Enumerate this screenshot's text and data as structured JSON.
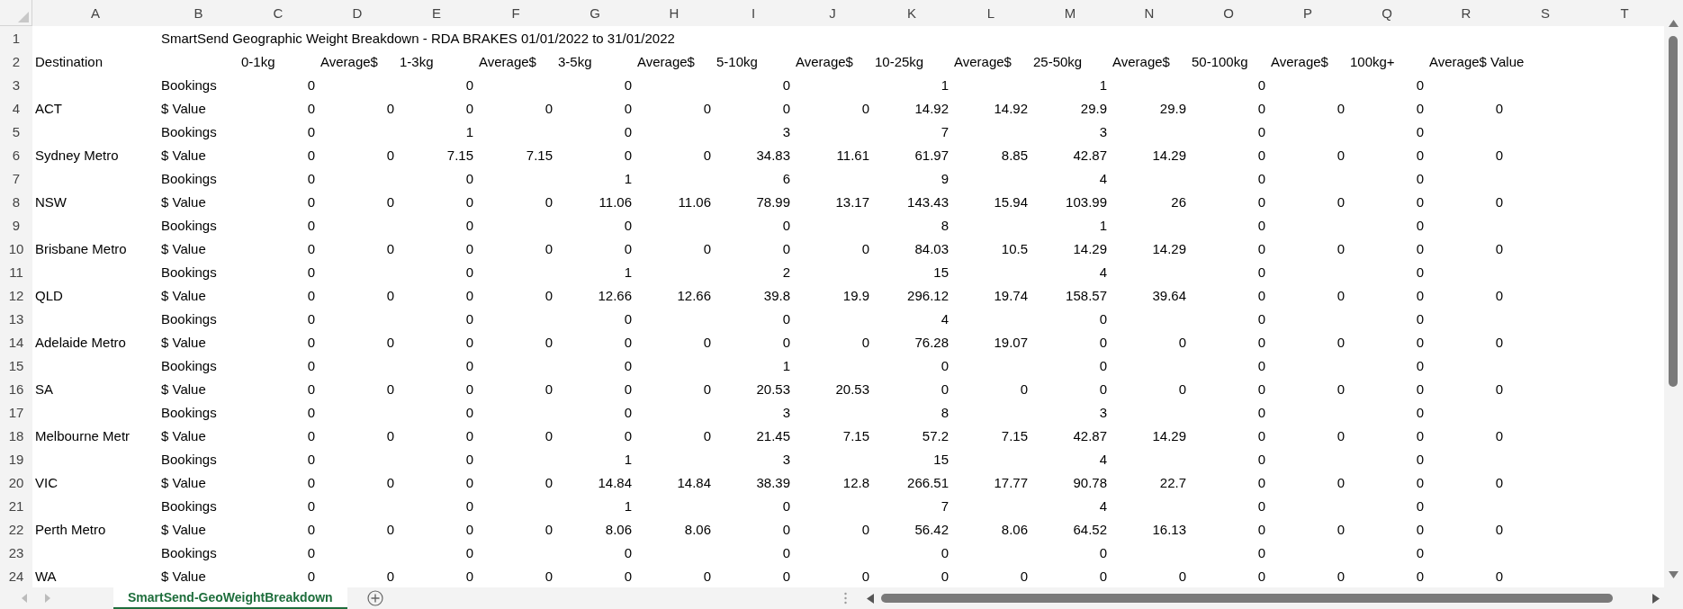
{
  "columns": [
    "A",
    "B",
    "C",
    "D",
    "E",
    "F",
    "G",
    "H",
    "I",
    "J",
    "K",
    "L",
    "M",
    "N",
    "O",
    "P",
    "Q",
    "R",
    "S",
    "T"
  ],
  "rows": [
    {
      "number": "1",
      "kind": "title",
      "cells": [
        null,
        "SmartSend Geographic Weight Breakdown - RDA BRAKES 01/01/2022 to 31/01/2022"
      ]
    },
    {
      "number": "2",
      "kind": "header",
      "cells": [
        "Destination",
        null,
        "0-1kg",
        "Average$",
        "1-3kg",
        "Average$",
        "3-5kg",
        "Average$",
        "5-10kg",
        "Average$",
        "10-25kg",
        "Average$",
        "25-50kg",
        "Average$",
        "50-100kg",
        "Average$",
        "100kg+",
        "Average$ Value"
      ]
    },
    {
      "number": "3",
      "kind": "data",
      "cells": [
        null,
        "Bookings",
        "0",
        null,
        "0",
        null,
        "0",
        null,
        "0",
        null,
        "1",
        null,
        "1",
        null,
        "0",
        null,
        "0",
        null
      ]
    },
    {
      "number": "4",
      "kind": "data",
      "cells": [
        "ACT",
        "$ Value",
        "0",
        "0",
        "0",
        "0",
        "0",
        "0",
        "0",
        "0",
        "14.92",
        "14.92",
        "29.9",
        "29.9",
        "0",
        "0",
        "0",
        "0"
      ]
    },
    {
      "number": "5",
      "kind": "data",
      "cells": [
        null,
        "Bookings",
        "0",
        null,
        "1",
        null,
        "0",
        null,
        "3",
        null,
        "7",
        null,
        "3",
        null,
        "0",
        null,
        "0",
        null
      ]
    },
    {
      "number": "6",
      "kind": "data",
      "cells": [
        "Sydney Metro",
        "$ Value",
        "0",
        "0",
        "7.15",
        "7.15",
        "0",
        "0",
        "34.83",
        "11.61",
        "61.97",
        "8.85",
        "42.87",
        "14.29",
        "0",
        "0",
        "0",
        "0"
      ]
    },
    {
      "number": "7",
      "kind": "data",
      "cells": [
        null,
        "Bookings",
        "0",
        null,
        "0",
        null,
        "1",
        null,
        "6",
        null,
        "9",
        null,
        "4",
        null,
        "0",
        null,
        "0",
        null
      ]
    },
    {
      "number": "8",
      "kind": "data",
      "cells": [
        "NSW",
        "$ Value",
        "0",
        "0",
        "0",
        "0",
        "11.06",
        "11.06",
        "78.99",
        "13.17",
        "143.43",
        "15.94",
        "103.99",
        "26",
        "0",
        "0",
        "0",
        "0"
      ]
    },
    {
      "number": "9",
      "kind": "data",
      "cells": [
        null,
        "Bookings",
        "0",
        null,
        "0",
        null,
        "0",
        null,
        "0",
        null,
        "8",
        null,
        "1",
        null,
        "0",
        null,
        "0",
        null
      ]
    },
    {
      "number": "10",
      "kind": "data",
      "cells": [
        "Brisbane Metro",
        "$ Value",
        "0",
        "0",
        "0",
        "0",
        "0",
        "0",
        "0",
        "0",
        "84.03",
        "10.5",
        "14.29",
        "14.29",
        "0",
        "0",
        "0",
        "0"
      ]
    },
    {
      "number": "11",
      "kind": "data",
      "cells": [
        null,
        "Bookings",
        "0",
        null,
        "0",
        null,
        "1",
        null,
        "2",
        null,
        "15",
        null,
        "4",
        null,
        "0",
        null,
        "0",
        null
      ]
    },
    {
      "number": "12",
      "kind": "data",
      "cells": [
        "QLD",
        "$ Value",
        "0",
        "0",
        "0",
        "0",
        "12.66",
        "12.66",
        "39.8",
        "19.9",
        "296.12",
        "19.74",
        "158.57",
        "39.64",
        "0",
        "0",
        "0",
        "0"
      ]
    },
    {
      "number": "13",
      "kind": "data",
      "cells": [
        null,
        "Bookings",
        "0",
        null,
        "0",
        null,
        "0",
        null,
        "0",
        null,
        "4",
        null,
        "0",
        null,
        "0",
        null,
        "0",
        null
      ]
    },
    {
      "number": "14",
      "kind": "data",
      "cells": [
        "Adelaide Metro",
        "$ Value",
        "0",
        "0",
        "0",
        "0",
        "0",
        "0",
        "0",
        "0",
        "76.28",
        "19.07",
        "0",
        "0",
        "0",
        "0",
        "0",
        "0"
      ]
    },
    {
      "number": "15",
      "kind": "data",
      "cells": [
        null,
        "Bookings",
        "0",
        null,
        "0",
        null,
        "0",
        null,
        "1",
        null,
        "0",
        null,
        "0",
        null,
        "0",
        null,
        "0",
        null
      ]
    },
    {
      "number": "16",
      "kind": "data",
      "cells": [
        "SA",
        "$ Value",
        "0",
        "0",
        "0",
        "0",
        "0",
        "0",
        "20.53",
        "20.53",
        "0",
        "0",
        "0",
        "0",
        "0",
        "0",
        "0",
        "0"
      ]
    },
    {
      "number": "17",
      "kind": "data",
      "cells": [
        null,
        "Bookings",
        "0",
        null,
        "0",
        null,
        "0",
        null,
        "3",
        null,
        "8",
        null,
        "3",
        null,
        "0",
        null,
        "0",
        null
      ]
    },
    {
      "number": "18",
      "kind": "data",
      "cells": [
        "Melbourne Metr",
        "$ Value",
        "0",
        "0",
        "0",
        "0",
        "0",
        "0",
        "21.45",
        "7.15",
        "57.2",
        "7.15",
        "42.87",
        "14.29",
        "0",
        "0",
        "0",
        "0"
      ]
    },
    {
      "number": "19",
      "kind": "data",
      "cells": [
        null,
        "Bookings",
        "0",
        null,
        "0",
        null,
        "1",
        null,
        "3",
        null,
        "15",
        null,
        "4",
        null,
        "0",
        null,
        "0",
        null
      ]
    },
    {
      "number": "20",
      "kind": "data",
      "cells": [
        "VIC",
        "$ Value",
        "0",
        "0",
        "0",
        "0",
        "14.84",
        "14.84",
        "38.39",
        "12.8",
        "266.51",
        "17.77",
        "90.78",
        "22.7",
        "0",
        "0",
        "0",
        "0"
      ]
    },
    {
      "number": "21",
      "kind": "data",
      "cells": [
        null,
        "Bookings",
        "0",
        null,
        "0",
        null,
        "1",
        null,
        "0",
        null,
        "7",
        null,
        "4",
        null,
        "0",
        null,
        "0",
        null
      ]
    },
    {
      "number": "22",
      "kind": "data",
      "cells": [
        "Perth Metro",
        "$ Value",
        "0",
        "0",
        "0",
        "0",
        "8.06",
        "8.06",
        "0",
        "0",
        "56.42",
        "8.06",
        "64.52",
        "16.13",
        "0",
        "0",
        "0",
        "0"
      ]
    },
    {
      "number": "23",
      "kind": "data",
      "cells": [
        null,
        "Bookings",
        "0",
        null,
        "0",
        null,
        "0",
        null,
        "0",
        null,
        "0",
        null,
        "0",
        null,
        "0",
        null,
        "0",
        null
      ]
    },
    {
      "number": "24",
      "kind": "data",
      "cells": [
        "WA",
        "$ Value",
        "0",
        "0",
        "0",
        "0",
        "0",
        "0",
        "0",
        "0",
        "0",
        "0",
        "0",
        "0",
        "0",
        "0",
        "0",
        "0"
      ]
    }
  ],
  "sheet_tabs": [
    {
      "label": "SmartSend-GeoWeightBreakdown",
      "selected": true
    }
  ]
}
